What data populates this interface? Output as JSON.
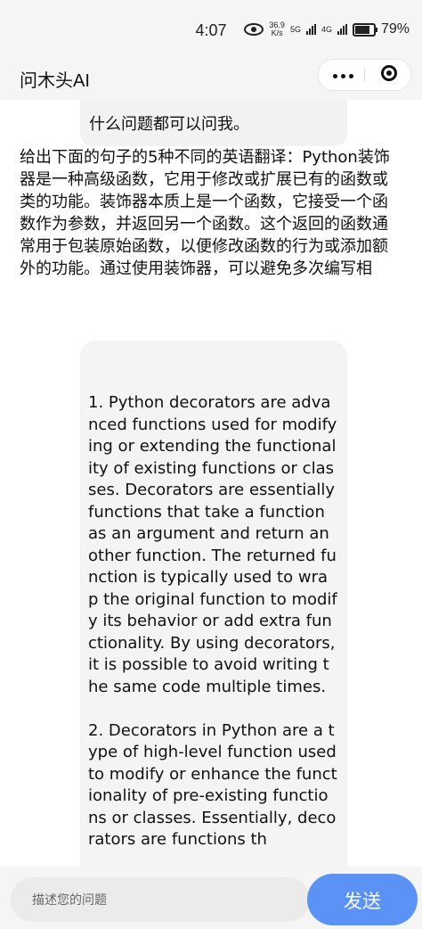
{
  "status_bar": {
    "time": "4:07",
    "net_speed_value": "36.9",
    "net_speed_unit": "K/s",
    "signal_1": "5G",
    "signal_2": "4G",
    "battery": "79%",
    "battery_level": 0.79
  },
  "nav": {
    "title": "问木头AI",
    "more_icon": "more-dots-icon",
    "close_icon": "target-icon"
  },
  "chat": {
    "assistant_intro_tail": "什么问题都可以问我。",
    "user_message": "给出下面的句子的5种不同的英语翻译：Python装饰器是一种高级函数，它用于修改或扩展已有的函数或类的功能。装饰器本质上是一个函数，它接受一个函数作为参数，并返回另一个函数。这个返回的函数通常用于包装原始函数，以便修改函数的行为或添加额外的功能。通过使用装饰器，可以避免多次编写相",
    "assistant_reply": "1. Python decorators are advanced functions used for modifying or extending the functionality of existing functions or classes. Decorators are essentially functions that take a function as an argument and return another function. The returned function is typically used to wrap the original function to modify its behavior or add extra functionality. By using decorators, it is possible to avoid writing the same code multiple times.\n\n2. Decorators in Python are a type of high-level function used to modify or enhance the functionality of pre-existing functions or classes. Essentially, decorators are functions th"
  },
  "input": {
    "placeholder": "描述您的问题",
    "send_label": "发送"
  },
  "colors": {
    "send_button": "#5a92f5",
    "bubble": "#f4f4f4",
    "background": "#ffffff"
  }
}
